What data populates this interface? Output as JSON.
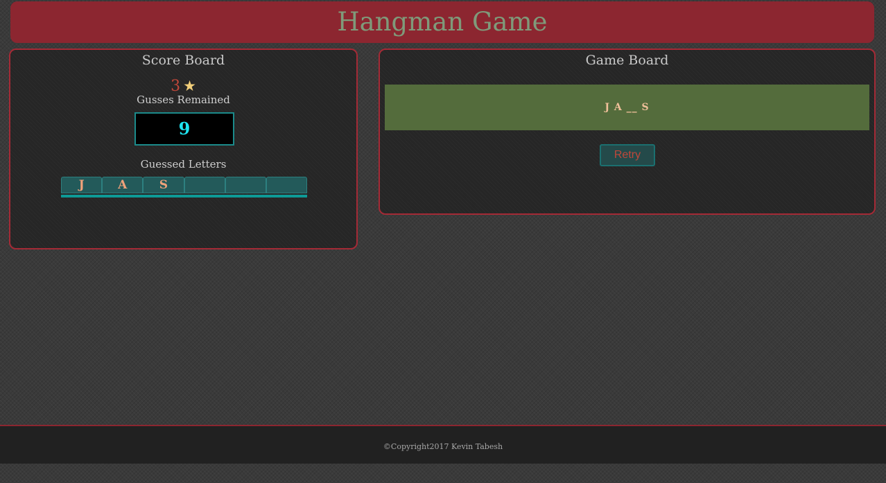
{
  "header": {
    "title": "Hangman Game"
  },
  "score_board": {
    "title": "Score Board",
    "score": "3",
    "star_icon": "★",
    "guesses_label": "Gusses Remained",
    "guesses_remaining": "9",
    "guessed_label": "Guessed Letters",
    "guessed_letters": [
      "J",
      "A",
      "S",
      "",
      "",
      ""
    ]
  },
  "game_board": {
    "title": "Game Board",
    "word_display": "J A __ S",
    "retry_label": "Retry"
  },
  "footer": {
    "copyright": "©Copyright2017 Kevin Tabesh"
  },
  "colors": {
    "header_bg": "#8c2630",
    "title_text": "#7f9a7a",
    "panel_border": "#a52a36",
    "word_bar_bg": "#546c3c",
    "guesses_text": "#1ee4f0",
    "letter_text": "#f0a27a"
  }
}
